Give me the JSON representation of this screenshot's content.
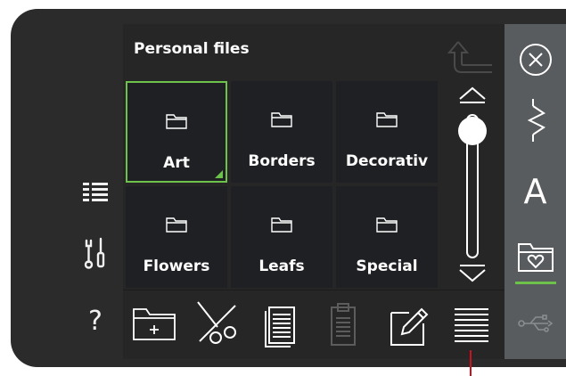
{
  "panel": {
    "title": "Personal files"
  },
  "folders": [
    {
      "label": "Art",
      "selected": true
    },
    {
      "label": "Borders",
      "selected": false
    },
    {
      "label": "Decorativ",
      "selected": false
    },
    {
      "label": "Flowers",
      "selected": false
    },
    {
      "label": "Leafs",
      "selected": false
    },
    {
      "label": "Special",
      "selected": false
    }
  ],
  "left_toolbar": {
    "help_label": "?"
  },
  "right_toolbar": {
    "text_label": "A"
  },
  "colors": {
    "accent": "#6cc24a",
    "panel_bg": "#262626",
    "tile_bg": "#1f2024",
    "sidebar_bg": "#595c5f",
    "marker": "#d01020"
  },
  "icons": [
    "list-view-icon",
    "tools-icon",
    "help-icon",
    "back-arrow-icon",
    "folder-icon",
    "scroll-up-icon",
    "scroll-handle-icon",
    "scroll-down-icon",
    "new-folder-icon",
    "cut-icon",
    "copy-icon",
    "paste-icon",
    "rename-icon",
    "view-list-icon",
    "close-icon",
    "stitch-icon",
    "text-icon",
    "personal-folder-icon",
    "usb-icon"
  ]
}
